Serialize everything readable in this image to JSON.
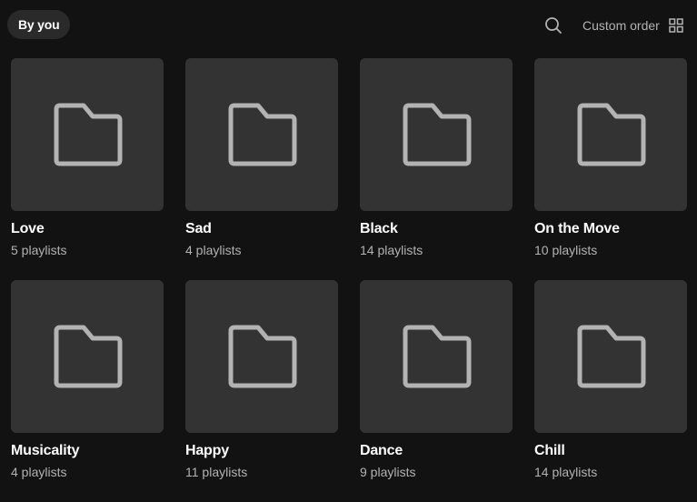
{
  "filter": {
    "chip_label": "By you"
  },
  "toolbar": {
    "search_icon": "search-icon",
    "sort_label": "Custom order",
    "view_icon": "grid-view-icon"
  },
  "folders": [
    {
      "title": "Love",
      "subtitle": "5 playlists"
    },
    {
      "title": "Sad",
      "subtitle": "4 playlists"
    },
    {
      "title": "Black",
      "subtitle": "14 playlists"
    },
    {
      "title": "On the Move",
      "subtitle": "10 playlists"
    },
    {
      "title": "Musicality",
      "subtitle": "4 playlists"
    },
    {
      "title": "Happy",
      "subtitle": "11 playlists"
    },
    {
      "title": "Dance",
      "subtitle": "9 playlists"
    },
    {
      "title": "Chill",
      "subtitle": "14 playlists"
    }
  ],
  "colors": {
    "background": "#121212",
    "card": "#333333",
    "chip": "#2a2a2a",
    "subtext": "#b3b3b3",
    "icon": "#b3b3b3"
  }
}
